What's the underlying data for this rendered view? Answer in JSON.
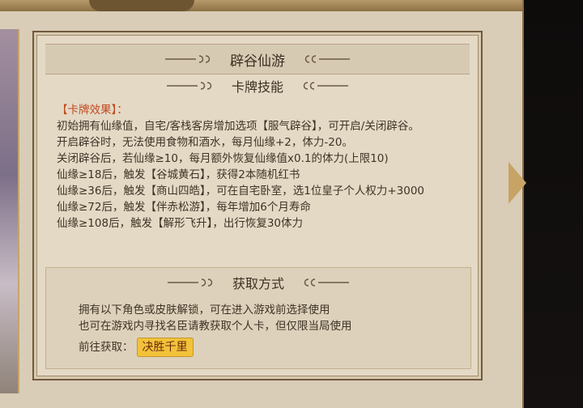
{
  "section_title": "辟谷仙游",
  "skill": {
    "heading": "卡牌技能",
    "effect_title": "【卡牌效果】：",
    "lines": [
      "初始拥有仙缘值，自宅/客栈客房增加选项【服气辟谷】，可开启/关闭辟谷。",
      "开启辟谷时，无法使用食物和酒水，每月仙缘+2，体力-20。",
      "关闭辟谷后，若仙缘≥10，每月额外恢复仙缘值x0.1的体力(上限10)",
      "仙缘≥18后，触发【谷城黄石】，获得2本随机红书",
      "仙缘≥36后，触发【商山四皓】，可在自宅卧室，选1位皇子个人权力+3000",
      "仙缘≥72后，触发【伴赤松游】，每年增加6个月寿命",
      "仙缘≥108后，触发【解形飞升】，出行恢复30体力"
    ]
  },
  "obtain": {
    "heading": "获取方式",
    "lines": [
      "拥有以下角色或皮肤解锁，可在进入游戏前选择使用",
      "也可在游戏内寻找名臣请教获取个人卡，但仅限当局使用"
    ],
    "goto_label": "前往获取：",
    "goto_button": "决胜千里"
  }
}
